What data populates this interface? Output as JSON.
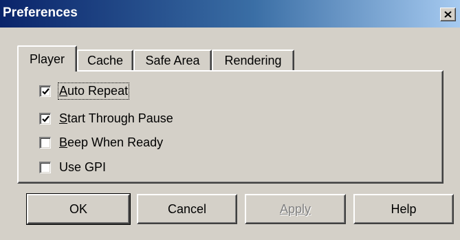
{
  "window": {
    "title": "Preferences",
    "close_icon": "close-icon"
  },
  "tabs": [
    {
      "label": "Player",
      "active": true
    },
    {
      "label": "Cache",
      "active": false
    },
    {
      "label": "Safe Area",
      "active": false
    },
    {
      "label": "Rendering",
      "active": false
    }
  ],
  "options": [
    {
      "label": "Auto Repeat",
      "accel": "A",
      "checked": true,
      "focused": true
    },
    {
      "label": "Start Through Pause",
      "accel": "S",
      "checked": true,
      "focused": false
    },
    {
      "label": "Beep When Ready",
      "accel": "B",
      "checked": false,
      "focused": false
    },
    {
      "label": "Use GPI",
      "accel": "",
      "checked": false,
      "focused": false
    }
  ],
  "buttons": {
    "ok": "OK",
    "cancel": "Cancel",
    "apply": "Apply",
    "help": "Help"
  },
  "colors": {
    "face": "#d4d0c8",
    "title_start": "#0a246a",
    "title_end": "#a6caf0",
    "disabled_text": "#808080"
  }
}
